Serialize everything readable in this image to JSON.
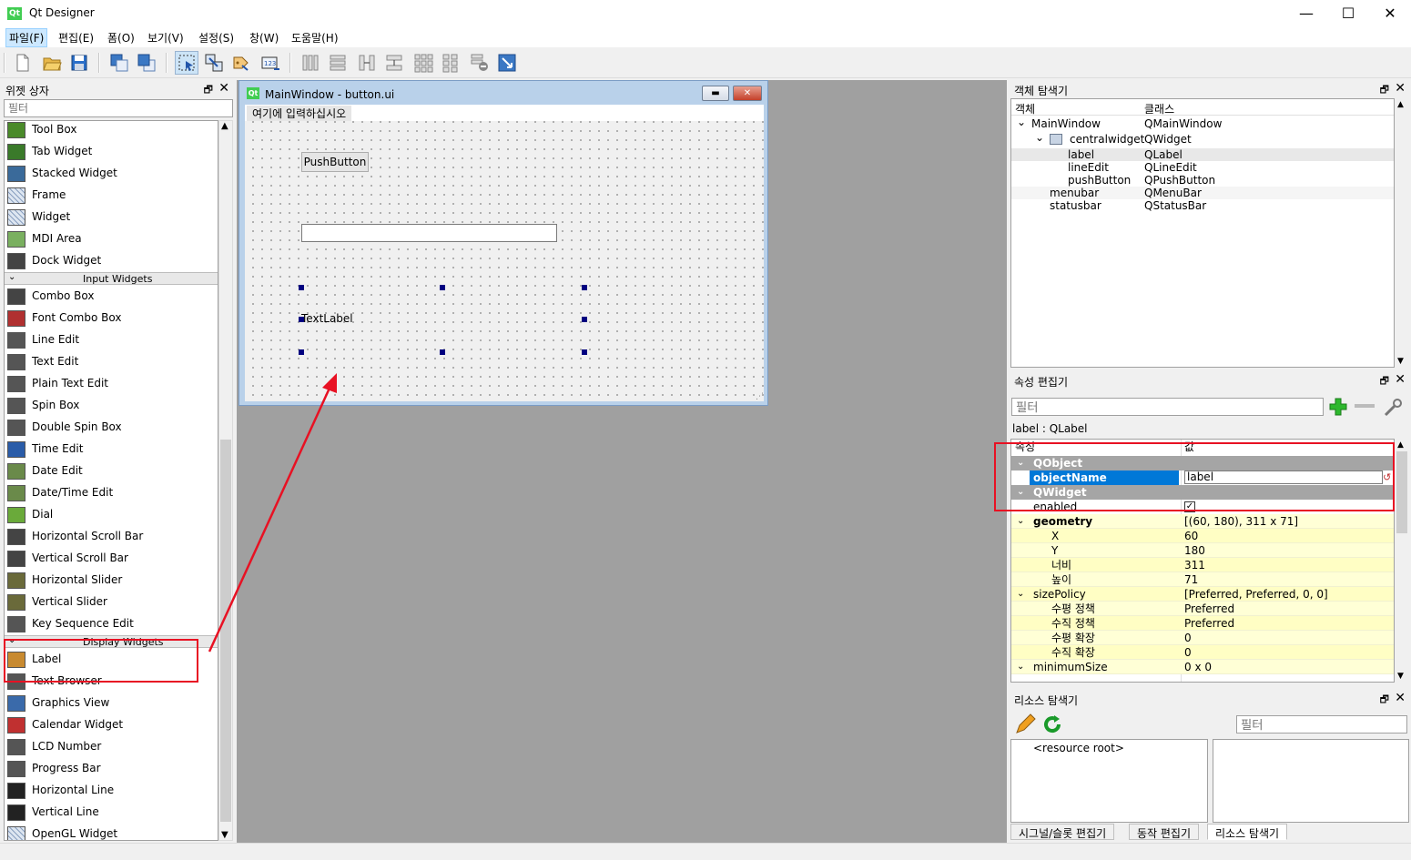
{
  "app": {
    "title": "Qt Designer",
    "logo": "Qt",
    "minimize": "—",
    "maximize": "☐",
    "close": "✕"
  },
  "menubar": [
    "파일(F)",
    "편집(E)",
    "폼(O)",
    "보기(V)",
    "설정(S)",
    "창(W)",
    "도움말(H)"
  ],
  "toolbar": {
    "icons": [
      "new-icon",
      "open-icon",
      "save-icon",
      "send-to-back-icon",
      "bring-to-front-icon",
      "edit-widgets-icon",
      "edit-signals-slots-icon",
      "edit-buddies-icon",
      "edit-tab-order-icon",
      "layout-horizontal-icon",
      "layout-vertical-icon",
      "layout-splitter-h-icon",
      "layout-splitter-v-icon",
      "layout-grid-icon",
      "layout-form-icon",
      "break-layout-icon",
      "adjust-size-icon"
    ]
  },
  "widget_box": {
    "title": "위젯 상자",
    "filter_placeholder": "필터",
    "items_top": [
      "Tool Box",
      "Tab Widget",
      "Stacked Widget",
      "Frame",
      "Widget",
      "MDI Area",
      "Dock Widget"
    ],
    "cat_input": "Input Widgets",
    "items_input": [
      "Combo Box",
      "Font Combo Box",
      "Line Edit",
      "Text Edit",
      "Plain Text Edit",
      "Spin Box",
      "Double Spin Box",
      "Time Edit",
      "Date Edit",
      "Date/Time Edit",
      "Dial",
      "Horizontal Scroll Bar",
      "Vertical Scroll Bar",
      "Horizontal Slider",
      "Vertical Slider",
      "Key Sequence Edit"
    ],
    "cat_display": "Display Widgets",
    "items_display": [
      "Label",
      "Text Browser",
      "Graphics View",
      "Calendar Widget",
      "LCD Number",
      "Progress Bar",
      "Horizontal Line",
      "Vertical Line",
      "OpenGL Widget"
    ]
  },
  "form": {
    "title": "MainWindow - button.ui",
    "type_here": "여기에 입력하십시오",
    "push_button": "PushButton",
    "text_label": "TextLabel"
  },
  "object_inspector": {
    "title": "객체 탐색기",
    "col_object": "객체",
    "col_class": "클래스",
    "rows": [
      {
        "name": "MainWindow",
        "cls": "QMainWindow"
      },
      {
        "name": "centralwidget",
        "cls": "QWidget"
      },
      {
        "name": "label",
        "cls": "QLabel"
      },
      {
        "name": "lineEdit",
        "cls": "QLineEdit"
      },
      {
        "name": "pushButton",
        "cls": "QPushButton"
      },
      {
        "name": "menubar",
        "cls": "QMenuBar"
      },
      {
        "name": "statusbar",
        "cls": "QStatusBar"
      }
    ]
  },
  "property_editor": {
    "title": "속성 편집기",
    "filter_placeholder": "필터",
    "class_line": "label : QLabel",
    "col_property": "속성",
    "col_value": "값",
    "rows": [
      {
        "k": "QObject",
        "v": ""
      },
      {
        "k": "objectName",
        "v": "label"
      },
      {
        "k": "QWidget",
        "v": ""
      },
      {
        "k": "enabled",
        "v": "✓"
      },
      {
        "k": "geometry",
        "v": "[(60, 180), 311 x 71]"
      },
      {
        "k": "X",
        "v": "60"
      },
      {
        "k": "Y",
        "v": "180"
      },
      {
        "k": "너비",
        "v": "311"
      },
      {
        "k": "높이",
        "v": "71"
      },
      {
        "k": "sizePolicy",
        "v": "[Preferred, Preferred, 0, 0]"
      },
      {
        "k": "수평 정책",
        "v": "Preferred"
      },
      {
        "k": "수직 정책",
        "v": "Preferred"
      },
      {
        "k": "수평 확장",
        "v": "0"
      },
      {
        "k": "수직 확장",
        "v": "0"
      },
      {
        "k": "minimumSize",
        "v": "0 x 0"
      }
    ]
  },
  "resource_browser": {
    "title": "리소스 탐색기",
    "filter_placeholder": "필터",
    "root": "<resource root>",
    "tabs": [
      "시그널/슬롯 편집기",
      "동작 편집기",
      "리소스 탐색기"
    ]
  },
  "colors": {
    "annotation": "#e81123",
    "selection_handle": "#000080",
    "group_row": "#a5a5a5",
    "objectname_highlight": "#0078d7"
  }
}
